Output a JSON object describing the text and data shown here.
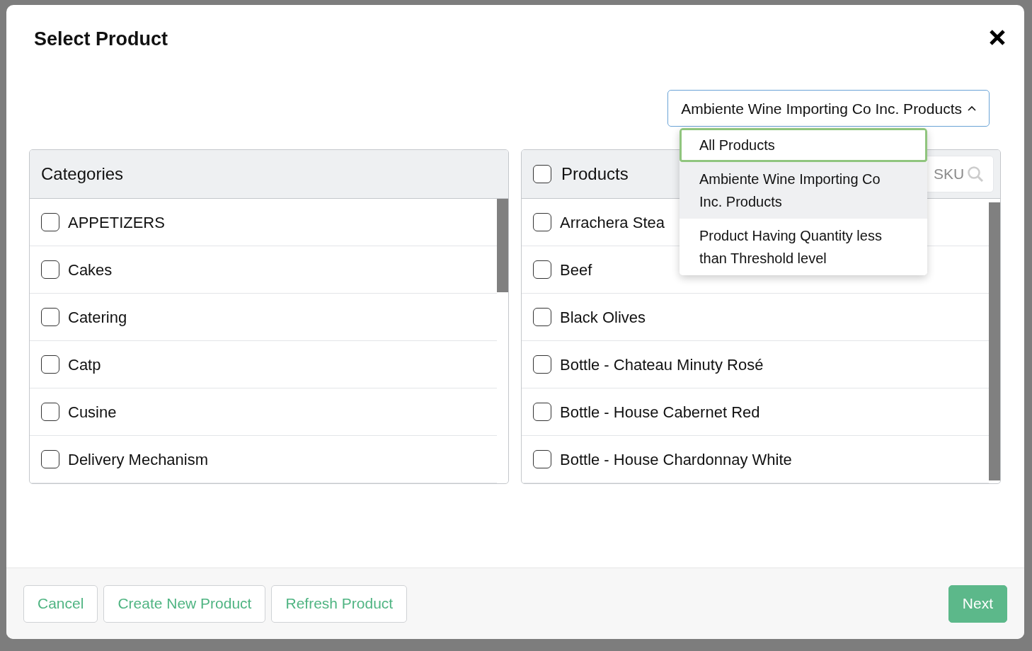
{
  "modal": {
    "title": "Select Product"
  },
  "filter": {
    "label": "Ambiente Wine Importing Co Inc. Products",
    "expanded": true,
    "options": [
      {
        "label": "All Products",
        "focused": true,
        "selected": false
      },
      {
        "label": "Ambiente Wine Importing Co Inc. Products",
        "focused": false,
        "selected": true
      },
      {
        "label": "Product Having Quantity less than Threshold level",
        "focused": false,
        "selected": false
      }
    ]
  },
  "categories": {
    "title": "Categories",
    "items": [
      {
        "label": "APPETIZERS",
        "checked": false
      },
      {
        "label": "Cakes",
        "checked": false
      },
      {
        "label": "Catering",
        "checked": false
      },
      {
        "label": "Catp",
        "checked": false
      },
      {
        "label": "Cusine",
        "checked": false
      },
      {
        "label": "Delivery Mechanism",
        "checked": false
      }
    ]
  },
  "products": {
    "title": "Products",
    "all_checked": false,
    "search": {
      "placeholder": "SKU"
    },
    "items": [
      {
        "label": "Arrachera Stea",
        "checked": false
      },
      {
        "label": "Beef",
        "checked": false
      },
      {
        "label": "Black Olives",
        "checked": false
      },
      {
        "label": "Bottle - Chateau Minuty Rosé",
        "checked": false
      },
      {
        "label": "Bottle - House Cabernet Red",
        "checked": false
      },
      {
        "label": "Bottle - House Chardonnay White",
        "checked": false
      }
    ]
  },
  "footer": {
    "buttons": [
      {
        "label": "Cancel",
        "kind": "outline"
      },
      {
        "label": "Create New Product",
        "kind": "outline"
      },
      {
        "label": "Refresh Product",
        "kind": "outline"
      },
      {
        "label": "Next",
        "kind": "primary"
      }
    ]
  }
}
